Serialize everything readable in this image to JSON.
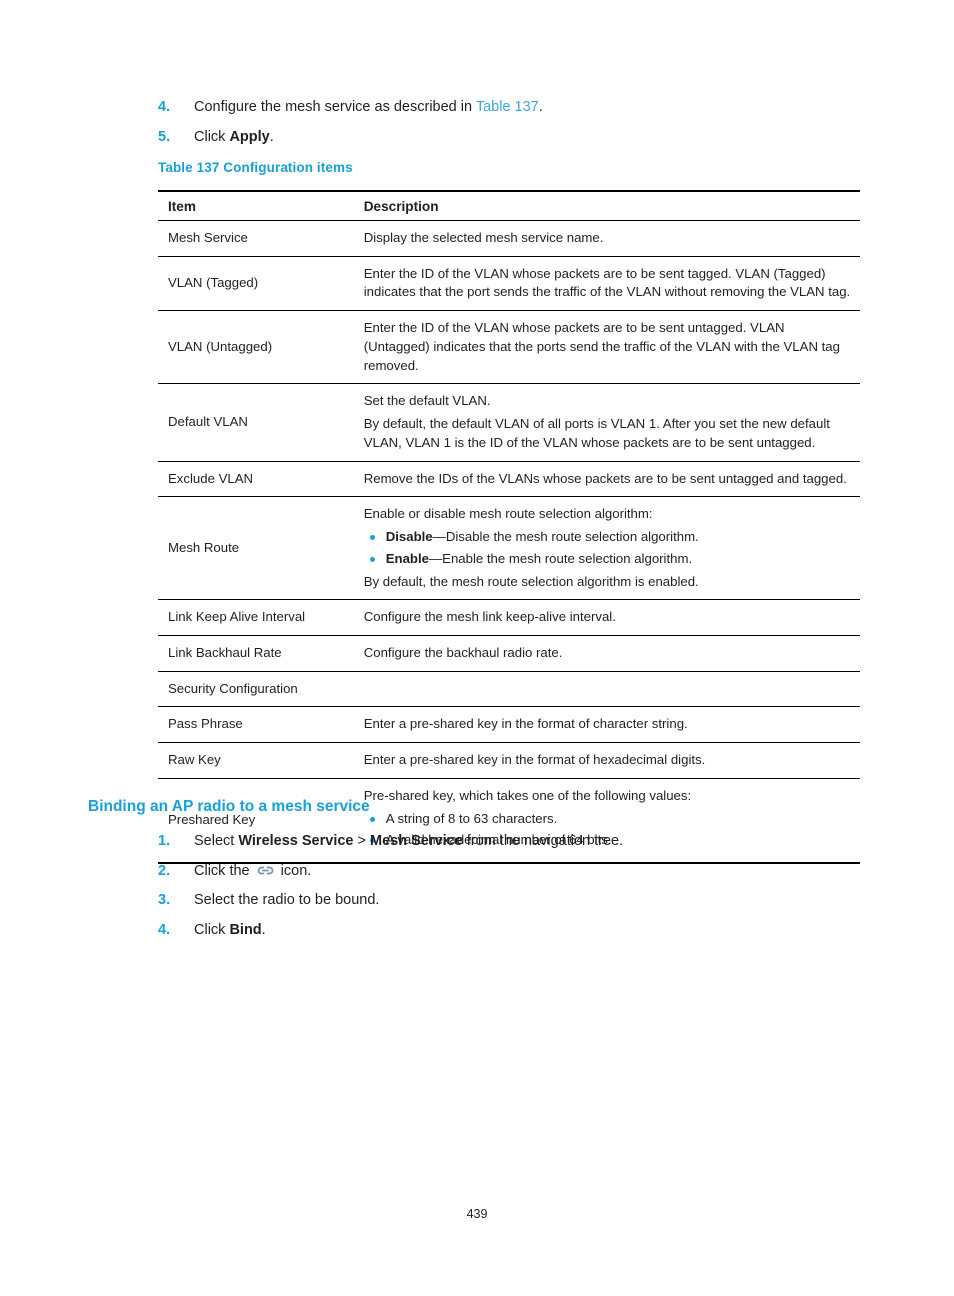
{
  "intro_steps": [
    {
      "num": "4.",
      "pre": "Configure the mesh service as described in ",
      "link": "Table 137",
      "post": "."
    },
    {
      "num": "5.",
      "pre": "Click ",
      "bold": "Apply",
      "post": "."
    }
  ],
  "table": {
    "caption": "Table 137 Configuration items",
    "headers": {
      "item": "Item",
      "description": "Description"
    },
    "rows": [
      {
        "item": "Mesh Service",
        "paras": [
          "Display the selected mesh service name."
        ],
        "bullets": [],
        "after": []
      },
      {
        "item": "VLAN (Tagged)",
        "paras": [
          "Enter the ID of the VLAN whose packets are to be sent tagged. VLAN (Tagged) indicates that the port sends the traffic of the VLAN without removing the VLAN tag."
        ],
        "bullets": [],
        "after": []
      },
      {
        "item": "VLAN (Untagged)",
        "paras": [
          "Enter the ID of the VLAN whose packets are to be sent untagged. VLAN (Untagged) indicates that the ports send the traffic of the VLAN with the VLAN tag removed."
        ],
        "bullets": [],
        "after": []
      },
      {
        "item": "Default VLAN",
        "paras": [
          "Set the default VLAN.",
          "By default, the default VLAN of all ports is VLAN 1. After you set the new default VLAN, VLAN 1 is the ID of the VLAN whose packets are to be sent untagged."
        ],
        "bullets": [],
        "after": []
      },
      {
        "item": "Exclude VLAN",
        "paras": [
          "Remove the IDs of the VLANs whose packets are to be sent untagged and tagged."
        ],
        "bullets": [],
        "after": []
      },
      {
        "item": "Mesh Route",
        "paras": [
          "Enable or disable mesh route selection algorithm:"
        ],
        "bullets": [
          {
            "bold": "Disable",
            "rest": "—Disable the mesh route selection algorithm."
          },
          {
            "bold": "Enable",
            "rest": "—Enable the mesh route selection algorithm."
          }
        ],
        "after": [
          "By default, the mesh route selection algorithm is enabled."
        ]
      },
      {
        "item": "Link Keep Alive Interval",
        "paras": [
          "Configure the mesh link keep-alive interval."
        ],
        "bullets": [],
        "after": []
      },
      {
        "item": "Link Backhaul Rate",
        "paras": [
          "Configure the backhaul radio rate."
        ],
        "bullets": [],
        "after": []
      },
      {
        "item": "Security Configuration",
        "paras": [],
        "bullets": [],
        "after": []
      },
      {
        "item": "Pass Phrase",
        "paras": [
          "Enter a pre-shared key in the format of character string."
        ],
        "bullets": [],
        "after": []
      },
      {
        "item": "Raw Key",
        "paras": [
          "Enter a pre-shared key in the format of hexadecimal digits."
        ],
        "bullets": [],
        "after": []
      },
      {
        "item": "Preshared Key",
        "paras": [
          "Pre-shared key, which takes one of the following values:"
        ],
        "bullets": [
          {
            "bold": "",
            "rest": "A string of 8 to 63 characters."
          },
          {
            "bold": "",
            "rest": "A valid hexadecimal number of 64 bits."
          }
        ],
        "after": []
      }
    ]
  },
  "section": {
    "heading": "Binding an AP radio to a mesh service",
    "steps": [
      {
        "num": "1.",
        "pre": "Select ",
        "bold1": "Wireless Service",
        "mid": " > ",
        "bold2": "Mesh Service",
        "post": " from the navigation tree."
      },
      {
        "num": "2.",
        "pre": "Click the ",
        "icon": "bind-link-icon",
        "post": " icon."
      },
      {
        "num": "3.",
        "pre": "Select the radio to be bound.",
        "post": ""
      },
      {
        "num": "4.",
        "pre": "Click ",
        "bold1": "Bind",
        "post": "."
      }
    ]
  },
  "footer": {
    "page_number": "439"
  },
  "colors": {
    "accent": "#18a0d8",
    "link": "#3aa7d9",
    "text": "#231f20",
    "icon": "#7b93a8"
  }
}
